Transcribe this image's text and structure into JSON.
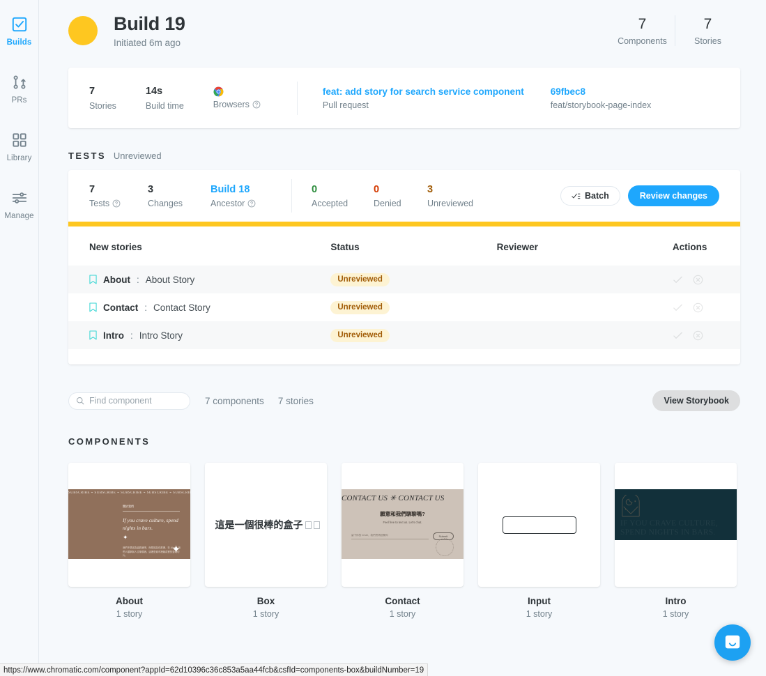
{
  "sidebar": {
    "items": [
      {
        "label": "Builds",
        "icon": "check-square-icon",
        "active": true
      },
      {
        "label": "PRs",
        "icon": "pull-request-icon",
        "active": false
      },
      {
        "label": "Library",
        "icon": "grid-icon",
        "active": false
      },
      {
        "label": "Manage",
        "icon": "sliders-icon",
        "active": false
      }
    ]
  },
  "header": {
    "title": "Build 19",
    "subtitle": "Initiated 6m ago",
    "status_color": "#fec720",
    "stats": [
      {
        "value": "7",
        "label": "Components"
      },
      {
        "value": "7",
        "label": "Stories"
      }
    ]
  },
  "summary": {
    "stats": [
      {
        "value": "7",
        "label": "Stories"
      },
      {
        "value": "14s",
        "label": "Build time"
      }
    ],
    "browsers_label": "Browsers",
    "browsers_icon": "chrome-icon",
    "pull_request": {
      "title": "feat: add story for search service component",
      "label": "Pull request"
    },
    "commit": {
      "hash": "69fbec8",
      "branch": "feat/storybook-page-index"
    }
  },
  "tests": {
    "section_title": "TESTS",
    "section_status": "Unreviewed",
    "stats": [
      {
        "value": "7",
        "label": "Tests",
        "help": true,
        "color": "#2e3438"
      },
      {
        "value": "3",
        "label": "Changes",
        "help": false,
        "color": "#2e3438"
      },
      {
        "value": "Build 18",
        "label": "Ancestor",
        "help": true,
        "color": "#1ea7fd"
      }
    ],
    "review_stats": [
      {
        "value": "0",
        "label": "Accepted",
        "color": "#2c8c3c"
      },
      {
        "value": "0",
        "label": "Denied",
        "color": "#d43900"
      },
      {
        "value": "3",
        "label": "Unreviewed",
        "color": "#a15c07"
      }
    ],
    "batch_button": "Batch",
    "review_button": "Review changes",
    "progress_color": "#fec720",
    "table": {
      "columns": [
        "New stories",
        "Status",
        "Reviewer",
        "Actions"
      ],
      "rows": [
        {
          "component": "About",
          "separator": ":",
          "story": "About Story",
          "status": "Unreviewed",
          "reviewer": ""
        },
        {
          "component": "Contact",
          "separator": ":",
          "story": "Contact Story",
          "status": "Unreviewed",
          "reviewer": ""
        },
        {
          "component": "Intro",
          "separator": ":",
          "story": "Intro Story",
          "status": "Unreviewed",
          "reviewer": ""
        }
      ]
    }
  },
  "filter": {
    "search_placeholder": "Find component",
    "search_value": "",
    "component_count": "7 components",
    "story_count": "7 stories",
    "storybook_button": "View Storybook"
  },
  "components": {
    "heading": "COMPONENTS",
    "items": [
      {
        "name": "About",
        "stories": "1 story"
      },
      {
        "name": "Box",
        "stories": "1 story"
      },
      {
        "name": "Contact",
        "stories": "1 story"
      },
      {
        "name": "Input",
        "stories": "1 story"
      },
      {
        "name": "Intro",
        "stories": "1 story"
      }
    ],
    "previews": {
      "about": {
        "marquee": "SUBSCRIBE ⌁ SUBSCRIBE ⌁ SUBSCRIBE ⌁ SUBSCRIBE ⌁ SUBSCRIBE ⌁",
        "kicker": "關於我們",
        "quote": "If you crave culture, spend nights in bars.",
        "body": "我們不是因為喜歡酒吧，而是因為在那裡，在 Alexis, 我們人類學與人文學原貌。這裡是城市裡最真實的靈魂切片。",
        "bg_color": "#90705b"
      },
      "box": {
        "text": "這是一個很棒的盒子",
        "tofu_count": 2
      },
      "contact": {
        "marquee": "CONTACT US ✳ CONTACT US",
        "heading": "願意和我們聊聊嗎?",
        "subtext": "Feel free to text us. Let's chat.",
        "input_placeholder": "留下你的 email，我們會再回覆你",
        "submit_label": "Submit",
        "bg_color": "#cdc2b8"
      },
      "input": {
        "type": "text-field"
      },
      "intro": {
        "text": "IF YOU CRAVE CULTURE, SPEND NIGHTS IN BARS.",
        "bg_color": "#12303a"
      }
    }
  },
  "intercom": {
    "label": "intercom-chat-button",
    "color": "#1da1f2"
  },
  "statusbar": {
    "url": "https://www.chromatic.com/component?appId=62d10396c36c853a5aa44fcb&csfId=components-box&buildNumber=19"
  }
}
